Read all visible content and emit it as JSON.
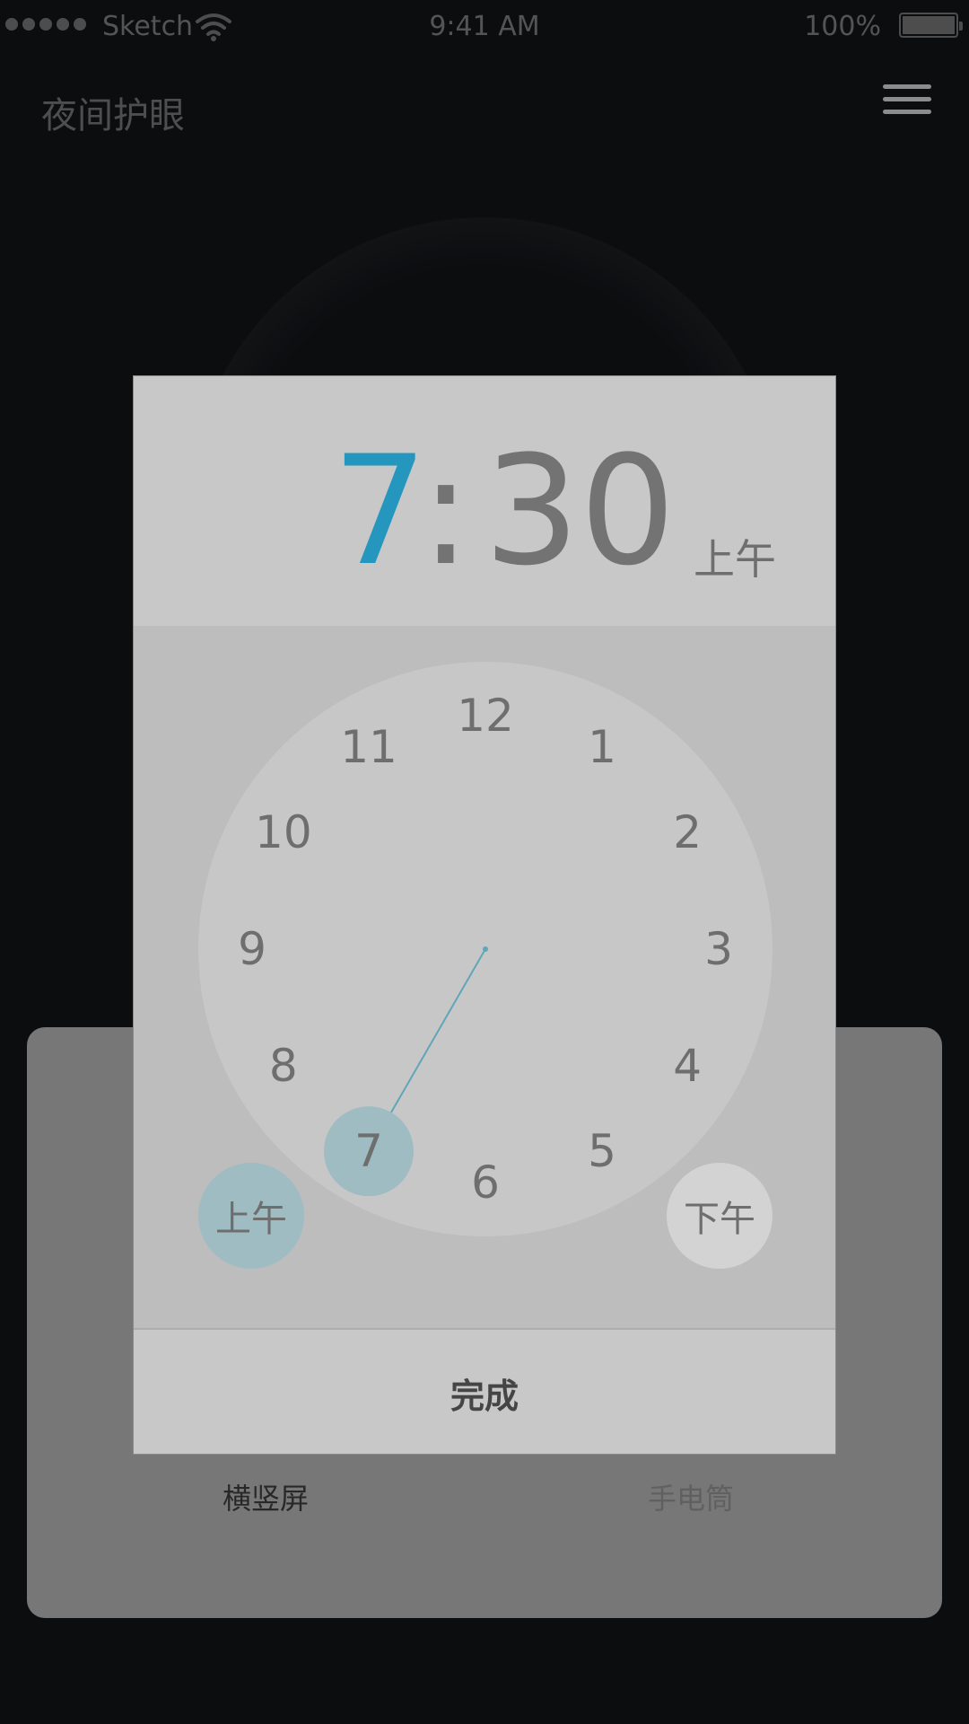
{
  "status_bar": {
    "carrier": "Sketch",
    "time": "9:41 AM",
    "battery": "100%"
  },
  "app": {
    "title": "夜间护眼"
  },
  "background": {
    "rotate_label": "横竖屏",
    "torch_label": "手电筒"
  },
  "time_picker": {
    "hour": "7",
    "colon": ":",
    "minute": "30",
    "period": "上午",
    "clock_numbers": [
      "12",
      "1",
      "2",
      "3",
      "4",
      "5",
      "6",
      "7",
      "8",
      "9",
      "10",
      "11"
    ],
    "selected_hour": 7,
    "am_label": "上午",
    "pm_label": "下午",
    "done_label": "完成"
  },
  "colors": {
    "accent": "#2596bd",
    "selection": "#9fbcc2",
    "hand": "#5fa6b8"
  },
  "icons": [
    "signal-dots-icon",
    "wifi-icon",
    "battery-icon",
    "menu-icon"
  ]
}
